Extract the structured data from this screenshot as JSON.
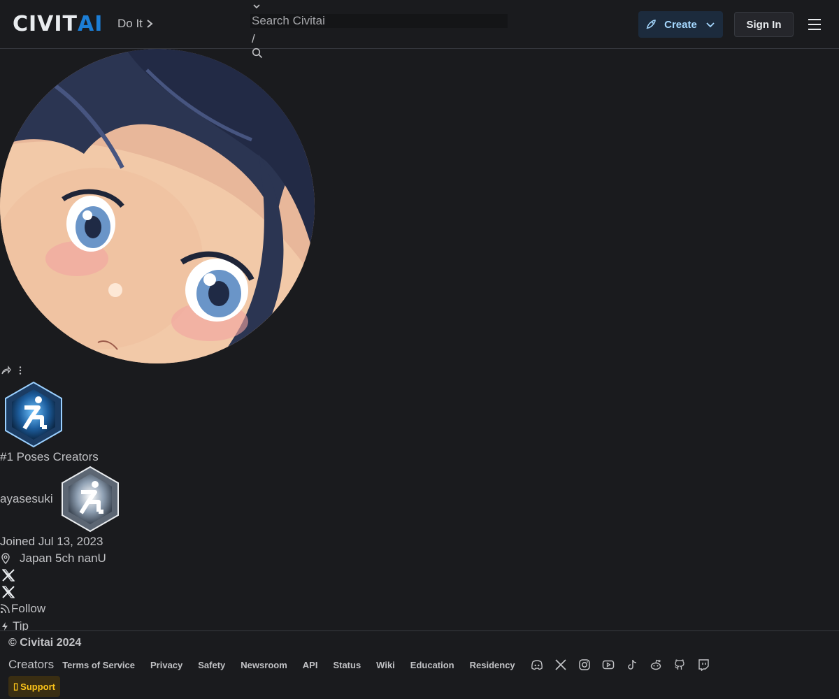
{
  "header": {
    "logo_main": "CIVIT",
    "logo_accent": "AI",
    "tagline": "Do It",
    "search_placeholder": "Search Civitai",
    "search_shortcut": "/",
    "create_label": "Create",
    "signin_label": "Sign In"
  },
  "profile": {
    "rank": "#1 Poses Creators",
    "username": "ayasesuki",
    "joined": "Joined Jul 13, 2023",
    "location": "Japan 5ch nanU",
    "follow_label": "Follow",
    "tip_label": "Tip"
  },
  "footer": {
    "copyright": "© Civitai 2024",
    "creators_label": "Creators",
    "links": [
      "Terms of Service",
      "Privacy",
      "Safety",
      "Newsroom",
      "API",
      "Status",
      "Wiki",
      "Education",
      "Residency"
    ],
    "support_label": "Support"
  },
  "colors": {
    "background": "#1a1b1e",
    "accent_blue": "#1c7ed6",
    "create_text": "#a5d8ff",
    "support_text": "#fcc419"
  },
  "icons": {
    "social": [
      "discord-icon",
      "x-icon",
      "instagram-icon",
      "youtube-icon",
      "tiktok-icon",
      "reddit-icon",
      "github-icon",
      "twitch-icon"
    ]
  }
}
